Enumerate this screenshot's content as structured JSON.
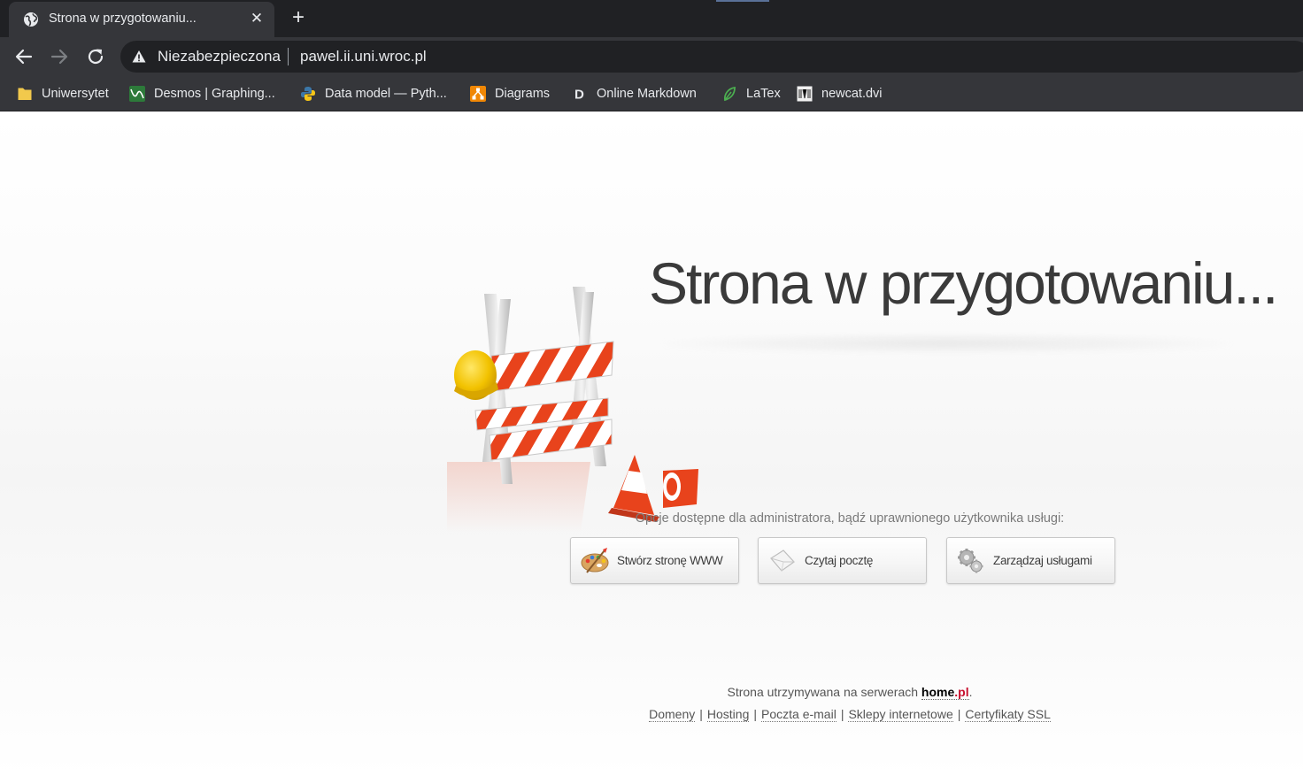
{
  "browser": {
    "tab": {
      "title": "Strona w przygotowaniu...",
      "close_glyph": "✕",
      "icon": "globe-icon"
    },
    "new_tab_glyph": "+",
    "omnibox": {
      "security_label": "Niezabezpieczona",
      "url": "pawel.ii.uni.wroc.pl",
      "icon": "warning-triangle-icon"
    },
    "bookmarks": [
      {
        "label": "Uniwersytet",
        "icon": "folder-icon"
      },
      {
        "label": "Desmos | Graphing...",
        "icon": "desmos-icon"
      },
      {
        "label": "Data model — Pyth...",
        "icon": "python-icon"
      },
      {
        "label": "Diagrams",
        "icon": "diagrams-icon"
      },
      {
        "label": "Online Markdown",
        "icon": "markdown-d-icon"
      },
      {
        "label": "LaTex",
        "icon": "leaf-icon"
      },
      {
        "label": "newcat.dvi",
        "icon": "document-icon"
      }
    ]
  },
  "page": {
    "title": "Strona w przygotowaniu...",
    "admin_label": "Opcje dostępne dla administratora, bądź uprawnionego użytkownika usługi:",
    "buttons": [
      {
        "label": "Stwórz stronę WWW",
        "icon": "palette-icon"
      },
      {
        "label": "Czytaj pocztę",
        "icon": "envelope-icon"
      },
      {
        "label": "Zarządzaj usługami",
        "icon": "gears-icon"
      }
    ],
    "footer": {
      "hosted_text": "Strona utrzymywana na serwerach ",
      "brand_a": "home",
      "brand_b": ".pl",
      "period": ".",
      "links": [
        "Domeny",
        "Hosting",
        "Poczta e-mail",
        "Sklepy internetowe",
        "Certyfikaty SSL"
      ],
      "separator": "|"
    }
  },
  "colors": {
    "chrome_dark": "#202124",
    "chrome_mid": "#35363a",
    "brand_red": "#c8102e",
    "barrier_red": "#e8431c"
  }
}
